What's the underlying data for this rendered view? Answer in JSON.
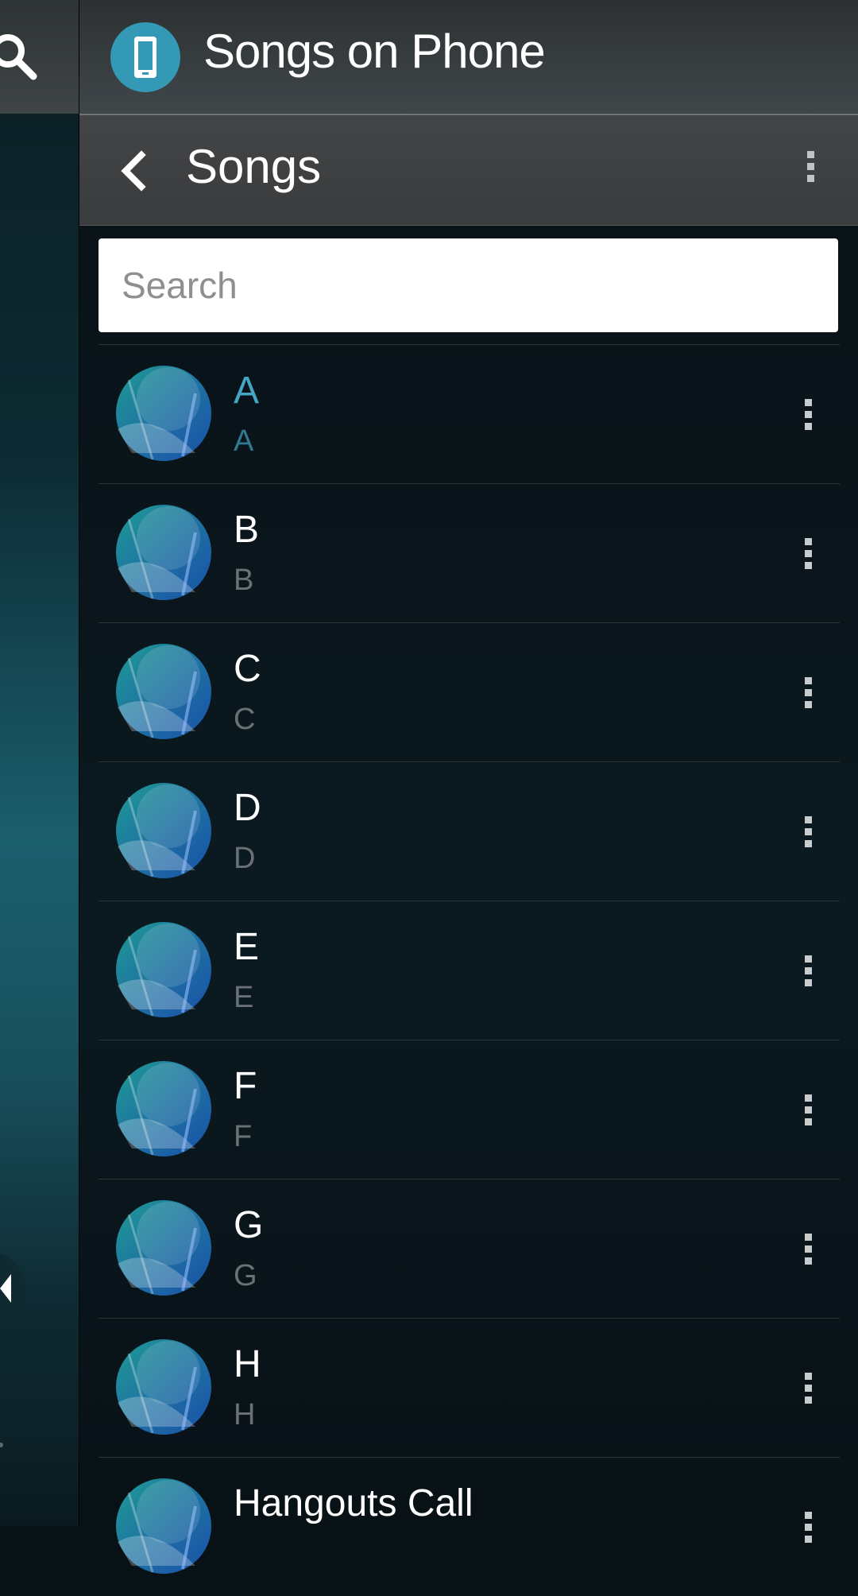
{
  "header": {
    "title": "Songs on Phone"
  },
  "subheader": {
    "title": "Songs"
  },
  "search": {
    "placeholder": "Search"
  },
  "songs": [
    {
      "title": "A",
      "subtitle": "A",
      "selected": true
    },
    {
      "title": "B",
      "subtitle": "B"
    },
    {
      "title": "C",
      "subtitle": "C"
    },
    {
      "title": "D",
      "subtitle": "D"
    },
    {
      "title": "E",
      "subtitle": "E"
    },
    {
      "title": "F",
      "subtitle": "F"
    },
    {
      "title": "G",
      "subtitle": "G"
    },
    {
      "title": "H",
      "subtitle": "H"
    },
    {
      "title": "Hangouts Call",
      "subtitle": ""
    }
  ],
  "colors": {
    "accent": "#45a6c4",
    "badge": "#3499b4"
  },
  "icons": {
    "search": "search-icon",
    "phone": "phone-icon",
    "back": "chevron-left-icon",
    "overflow": "more-vertical-icon",
    "album_art": "album-art-icon",
    "previous": "previous-icon"
  }
}
